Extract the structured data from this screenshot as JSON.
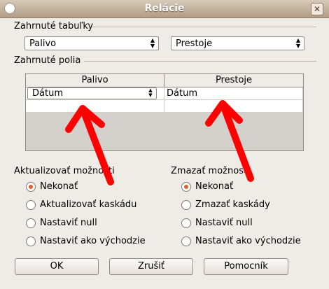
{
  "window": {
    "title": "Relácie"
  },
  "tables": {
    "label": "Zahrnuté tabuľky",
    "left_value": "Palivo",
    "right_value": "Prestoje"
  },
  "fields": {
    "label": "Zahrnuté polia",
    "columns": [
      "Palivo",
      "Prestoje"
    ],
    "rows": [
      {
        "left": "Dátum",
        "right": "Dátum"
      },
      {
        "left": "",
        "right": ""
      }
    ]
  },
  "update": {
    "label": "Aktualizovať možnosti",
    "options": [
      "Nekonať",
      "Aktualizovať kaskádu",
      "Nastaviť null",
      "Nastaviť ako východzie"
    ],
    "selected": 0
  },
  "delete": {
    "label": "Zmazať možnosti",
    "options": [
      "Nekonať",
      "Zmazať kaskády",
      "Nastaviť null",
      "Nastaviť ako východzie"
    ],
    "selected": 0
  },
  "buttons": {
    "ok": "OK",
    "cancel": "Zrušiť",
    "help": "Pomocník"
  },
  "annotation_color": "#ff0000"
}
